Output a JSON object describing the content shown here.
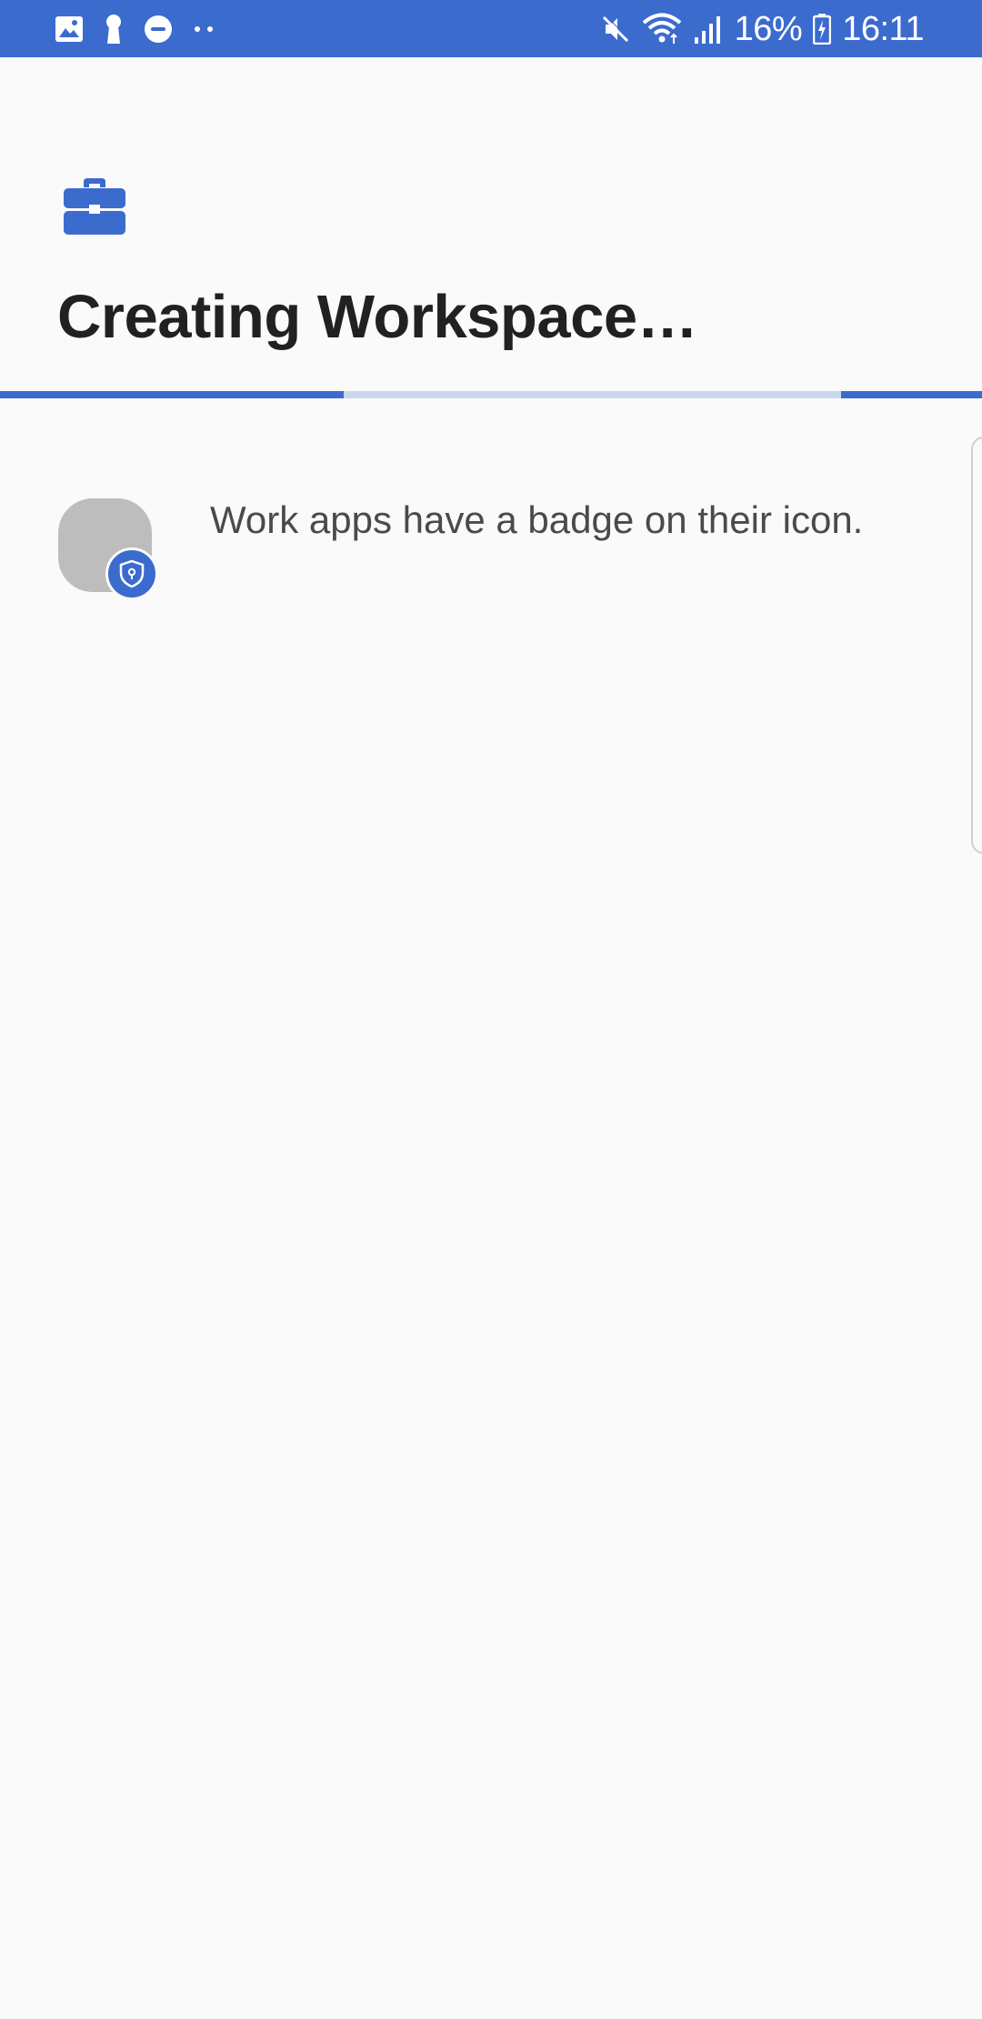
{
  "status_bar": {
    "battery_percent": "16%",
    "time": "16:11",
    "background_color": "#3c6bce",
    "left_icons": [
      "gallery-icon",
      "keyhole-icon",
      "do-not-disturb-icon",
      "more-notifications-icon"
    ],
    "right_icons": [
      "mute-icon",
      "wifi-icon",
      "signal-icon",
      "battery-charging-icon"
    ]
  },
  "header": {
    "icon": "briefcase-icon",
    "title": "Creating Workspace…"
  },
  "progress": {
    "style": "indeterminate",
    "accent_color": "#3c6bce",
    "track_color": "#c9d6f0"
  },
  "content": {
    "tip": {
      "icon": "app-placeholder-icon",
      "badge_icon": "shield-badge-icon",
      "text": "Work apps have a badge on their icon."
    }
  }
}
